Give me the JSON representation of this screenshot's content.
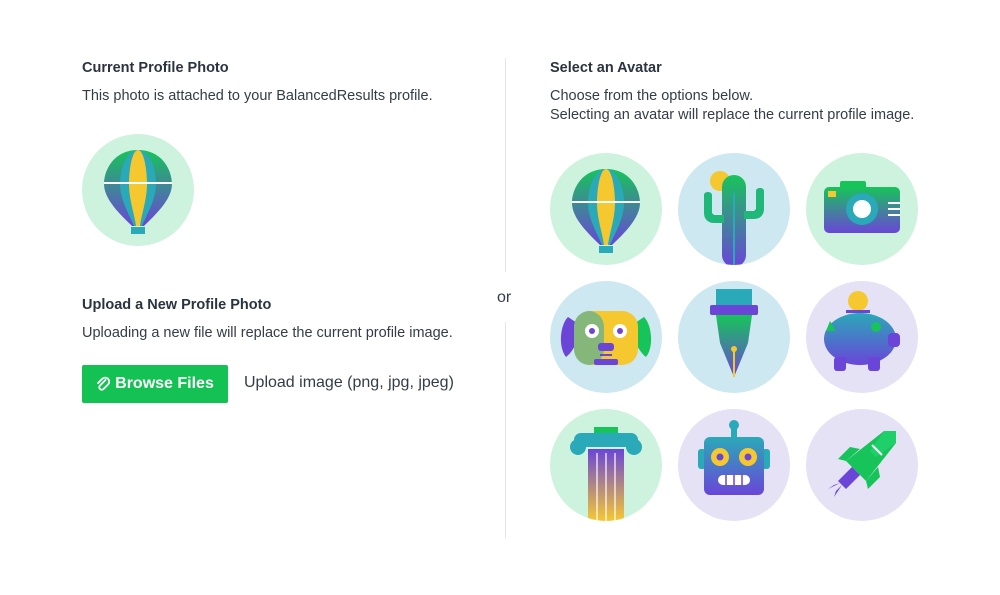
{
  "current_photo": {
    "heading": "Current Profile Photo",
    "description": "This photo is attached to your BalancedResults profile.",
    "icon": "hot-air-balloon-icon"
  },
  "upload": {
    "heading": "Upload a New Profile Photo",
    "description": "Uploading a new file will replace the current profile image.",
    "button_label": "Browse Files",
    "button_icon": "paperclip-icon",
    "hint": "Upload image (png, jpg, jpeg)"
  },
  "separator": {
    "label": "or"
  },
  "avatar_select": {
    "heading": "Select an Avatar",
    "description_line1": "Choose from the options below.",
    "description_line2": "Selecting an avatar will replace the current profile image.",
    "avatars": [
      {
        "icon": "hot-air-balloon-icon",
        "bg": "#cdf2de"
      },
      {
        "icon": "cactus-icon",
        "bg": "#cde8f0"
      },
      {
        "icon": "camera-icon",
        "bg": "#cdf2de"
      },
      {
        "icon": "dog-icon",
        "bg": "#cde8f0"
      },
      {
        "icon": "fountain-pen-icon",
        "bg": "#cde8f0"
      },
      {
        "icon": "piggy-bank-icon",
        "bg": "#e5e2f6"
      },
      {
        "icon": "column-icon",
        "bg": "#cdf2de"
      },
      {
        "icon": "robot-icon",
        "bg": "#e5e2f6"
      },
      {
        "icon": "rocket-icon",
        "bg": "#e5e2f6"
      }
    ]
  },
  "colors": {
    "primary_button": "#14c254",
    "text": "#2b3340",
    "divider": "#e4e6ea"
  }
}
